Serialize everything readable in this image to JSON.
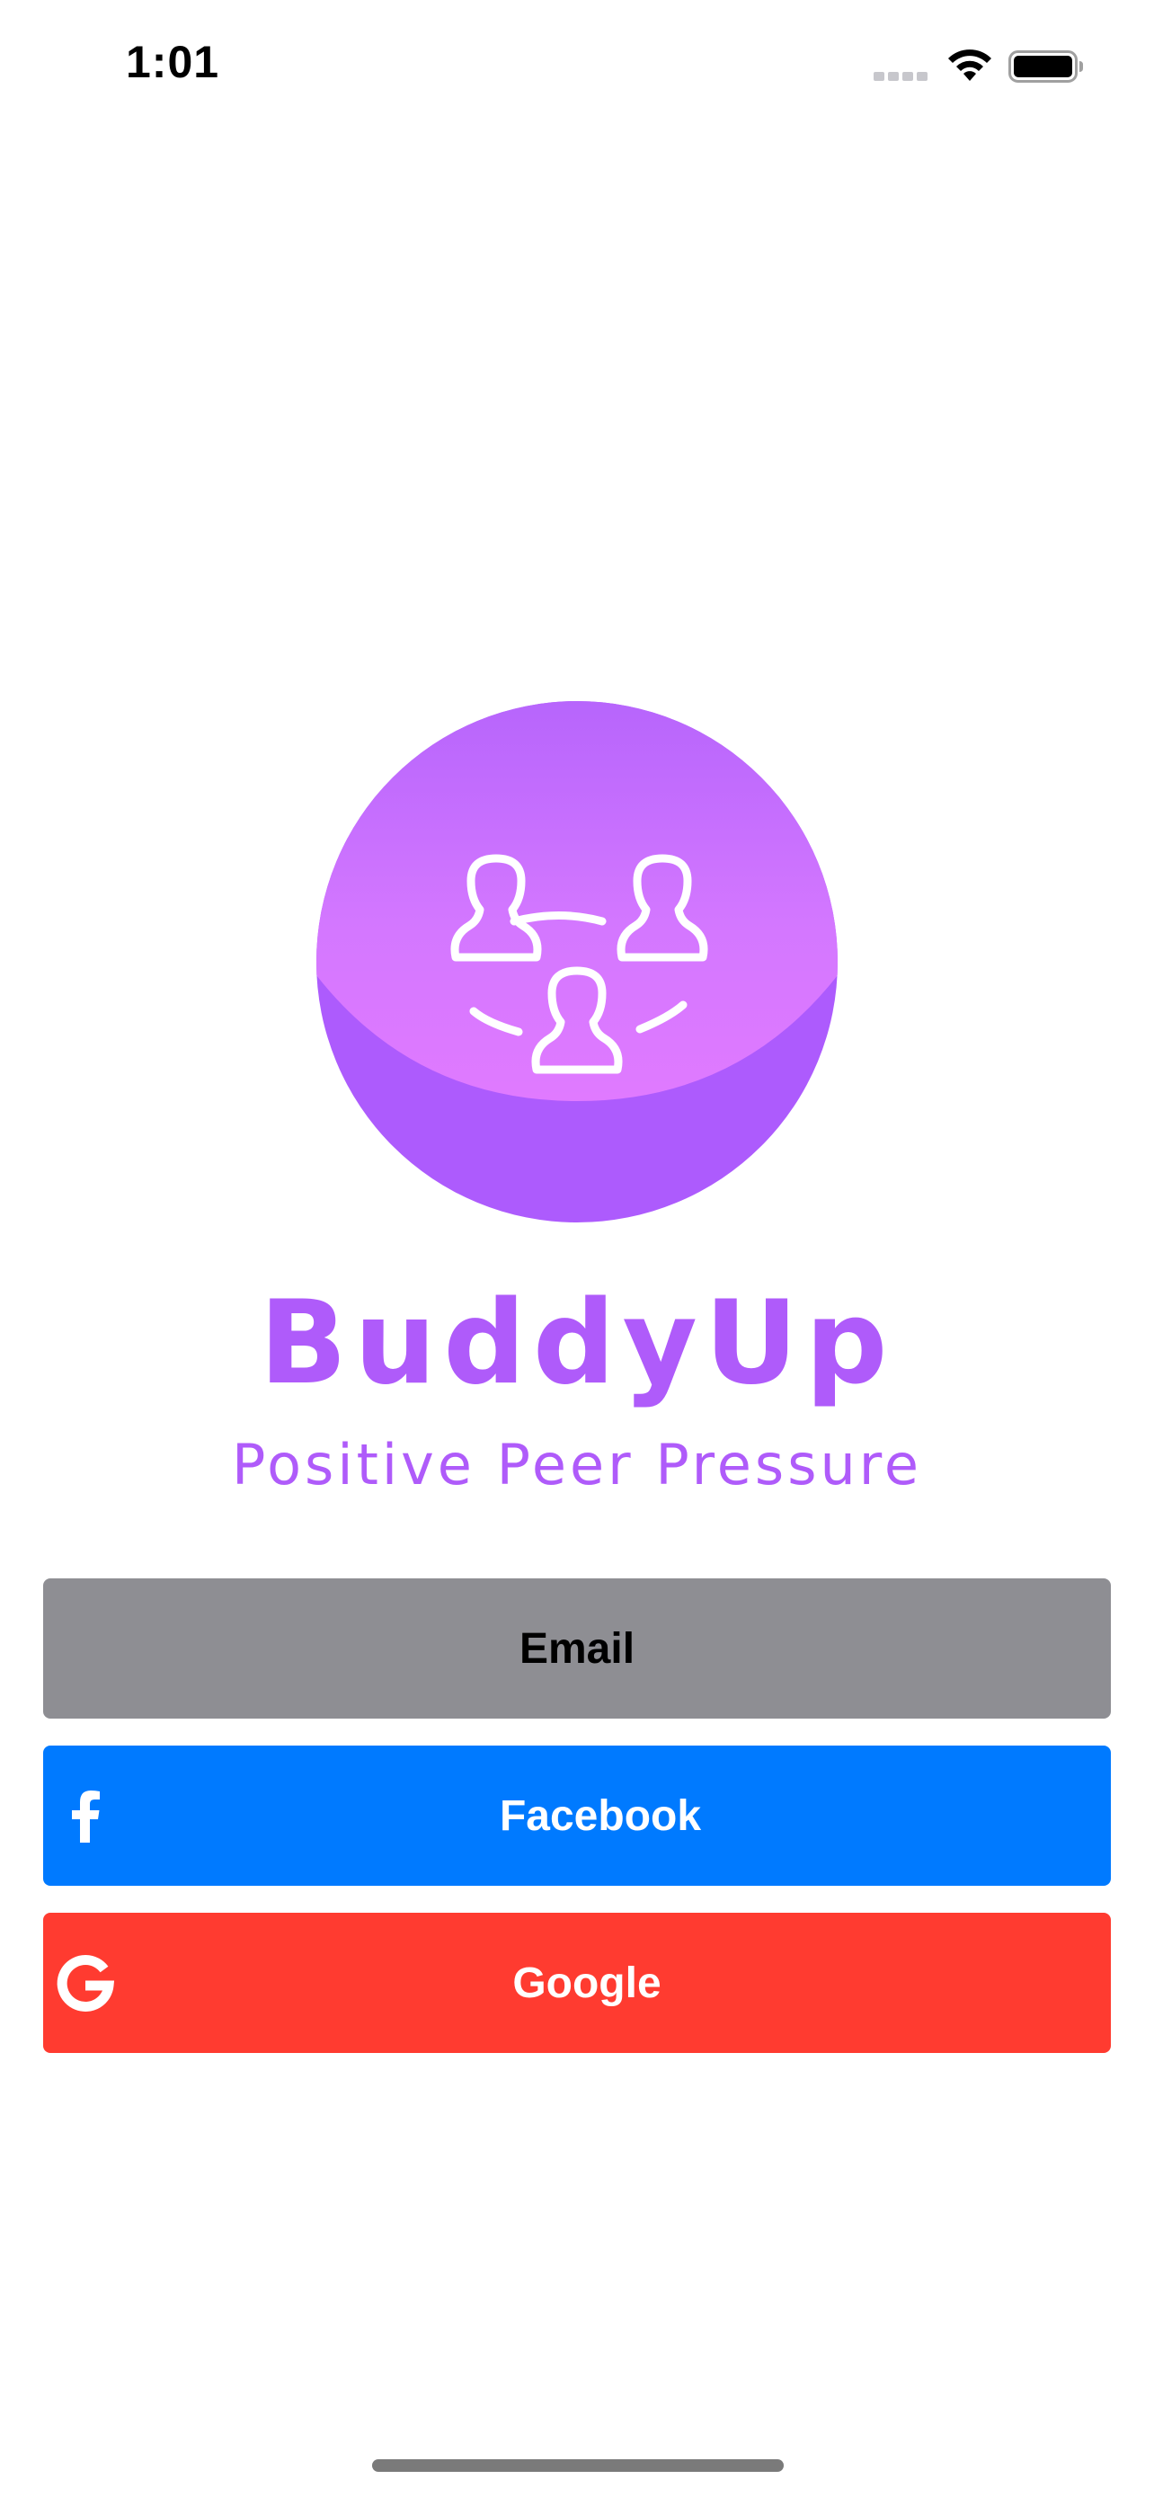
{
  "status_bar": {
    "time": "1:01",
    "icons": [
      "signal-icon",
      "wifi-icon",
      "battery-icon"
    ]
  },
  "app": {
    "logo_icon": "people-group-icon",
    "title": "BuddyUp",
    "tagline": "Positive Peer Pressure"
  },
  "buttons": {
    "email": {
      "label": "Email",
      "color": "#8e8e93"
    },
    "facebook": {
      "label": "Facebook",
      "color": "#007aff",
      "icon": "facebook-icon"
    },
    "google": {
      "label": "Google",
      "color": "#ff3b30",
      "icon": "google-icon"
    }
  },
  "colors": {
    "brand": "#af5bfa",
    "logo_top": "#b765fc",
    "logo_band": "#e07aff",
    "logo_bottom": "#ad5bfd"
  }
}
